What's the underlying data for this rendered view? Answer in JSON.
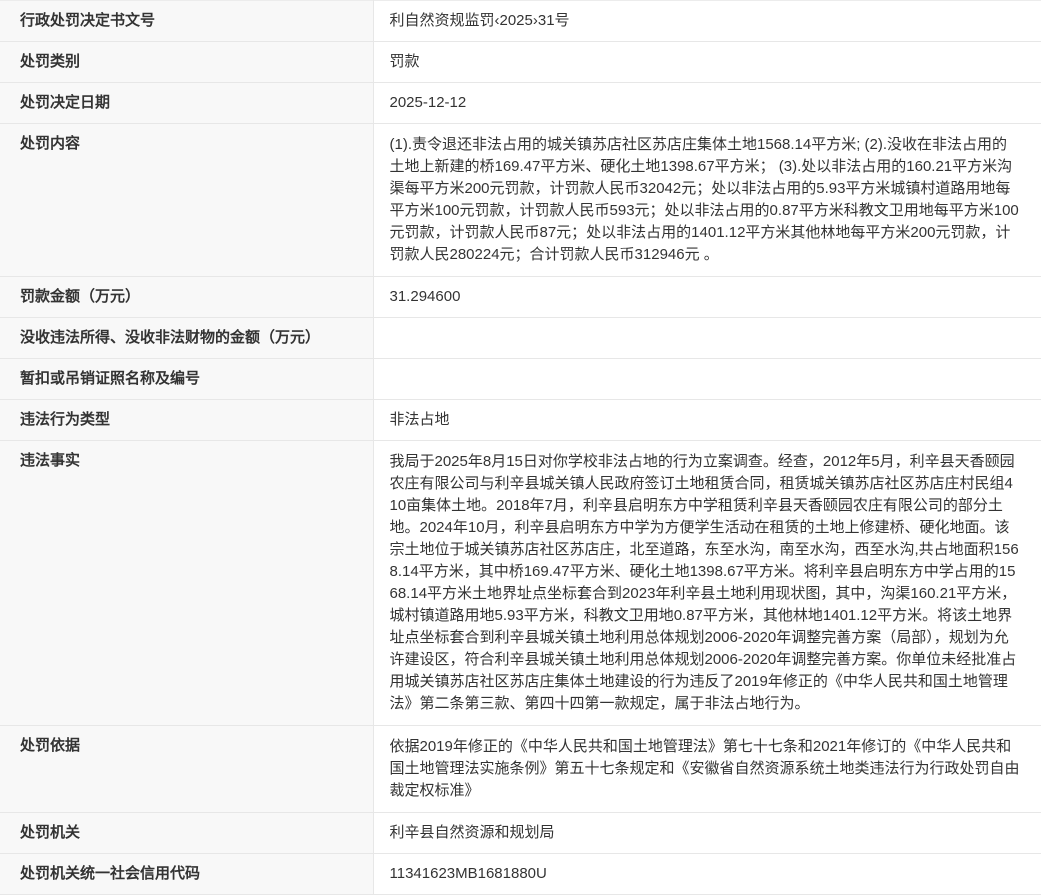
{
  "document": {
    "type": "行政处罚信息公示表",
    "colors": {
      "label_background": "#f8f8f8",
      "row_border": "#e7e7e7",
      "text": "#333333",
      "value_background": "#ffffff"
    },
    "rows": [
      {
        "label": "行政处罚决定书文号",
        "value": "利自然资规监罚‹2025›31号"
      },
      {
        "label": "处罚类别",
        "value": "罚款"
      },
      {
        "label": "处罚决定日期",
        "value": "2025-12-12"
      },
      {
        "label": "处罚内容",
        "value": "(1).责令退还非法占用的城关镇苏店社区苏店庄集体土地1568.14平方米; (2).没收在非法占用的土地上新建的桥169.47平方米、硬化土地1398.67平方米； (3).处以非法占用的160.21平方米沟渠每平方米200元罚款，计罚款人民币32042元；处以非法占用的5.93平方米城镇村道路用地每平方米100元罚款，计罚款人民币593元；处以非法占用的0.87平方米科教文卫用地每平方米100元罚款，计罚款人民币87元；处以非法占用的1401.12平方米其他林地每平方米200元罚款，计罚款人民280224元；合计罚款人民币312946元 。"
      },
      {
        "label": "罚款金额（万元）",
        "value": "31.294600"
      },
      {
        "label": "没收违法所得、没收非法财物的金额（万元）",
        "value": ""
      },
      {
        "label": "暂扣或吊销证照名称及编号",
        "value": ""
      },
      {
        "label": "违法行为类型",
        "value": "非法占地"
      },
      {
        "label": "违法事实",
        "value": "我局于2025年8月15日对你学校非法占地的行为立案调查。经查，2012年5月，利辛县天香颐园农庄有限公司与利辛县城关镇人民政府签订土地租赁合同，租赁城关镇苏店社区苏店庄村民组410亩集体土地。2018年7月，利辛县启明东方中学租赁利辛县天香颐园农庄有限公司的部分土地。2024年10月，利辛县启明东方中学为方便学生活动在租赁的土地上修建桥、硬化地面。该宗土地位于城关镇苏店社区苏店庄，北至道路，东至水沟，南至水沟，西至水沟,共占地面积1568.14平方米，其中桥169.47平方米、硬化土地1398.67平方米。将利辛县启明东方中学占用的1568.14平方米土地界址点坐标套合到2023年利辛县土地利用现状图，其中，沟渠160.21平方米，城村镇道路用地5.93平方米，科教文卫用地0.87平方米，其他林地1401.12平方米。将该土地界址点坐标套合到利辛县城关镇土地利用总体规划2006-2020年调整完善方案（局部），规划为允许建设区，符合利辛县城关镇土地利用总体规划2006-2020年调整完善方案。你单位未经批准占用城关镇苏店社区苏店庄集体土地建设的行为违反了2019年修正的《中华人民共和国土地管理法》第二条第三款、第四十四第一款规定，属于非法占地行为。"
      },
      {
        "label": "处罚依据",
        "value": "依据2019年修正的《中华人民共和国土地管理法》第七十七条和2021年修订的《中华人民共和国土地管理法实施条例》第五十七条规定和《安徽省自然资源系统土地类违法行为行政处罚自由裁定权标准》"
      },
      {
        "label": "处罚机关",
        "value": "利辛县自然资源和规划局"
      },
      {
        "label": "处罚机关统一社会信用代码",
        "value": "11341623MB1681880U"
      }
    ]
  }
}
